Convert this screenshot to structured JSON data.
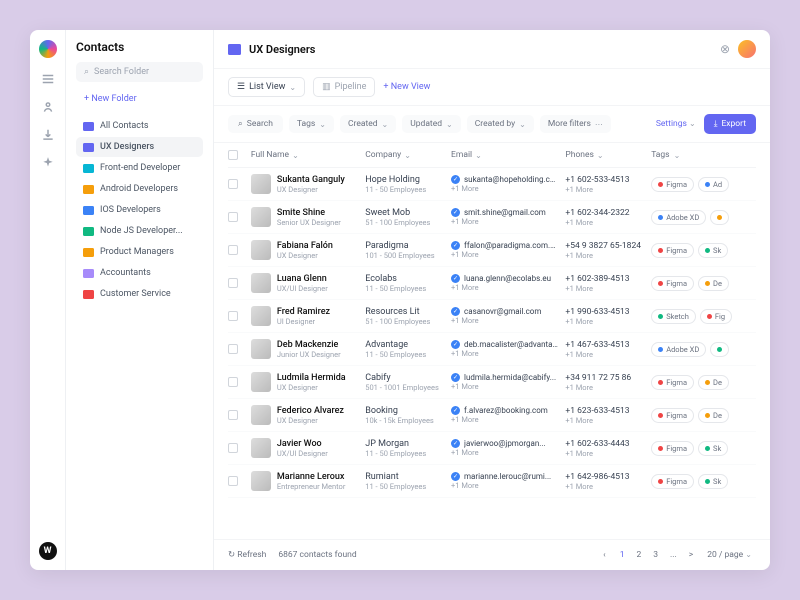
{
  "sidebar": {
    "title": "Contacts",
    "search_placeholder": "Search Folder",
    "new_folder": "+   New Folder",
    "folders": [
      {
        "label": "All Contacts",
        "color": "#6366f1"
      },
      {
        "label": "UX Designers",
        "color": "#6366f1",
        "active": true
      },
      {
        "label": "Front-end Developer",
        "color": "#06b6d4"
      },
      {
        "label": "Android Developers",
        "color": "#f59e0b"
      },
      {
        "label": "IOS Developers",
        "color": "#3b82f6"
      },
      {
        "label": "Node JS Developer...",
        "color": "#10b981"
      },
      {
        "label": "Product Managers",
        "color": "#f59e0b"
      },
      {
        "label": "Accountants",
        "color": "#a78bfa"
      },
      {
        "label": "Customer Service",
        "color": "#ef4444"
      }
    ]
  },
  "header": {
    "title": "UX Designers",
    "folder_color": "#6366f1"
  },
  "views": {
    "list": "List View",
    "pipeline": "Pipeline",
    "new": "+   New View"
  },
  "filters": {
    "search": "Search",
    "chips": [
      "Tags",
      "Created",
      "Updated",
      "Created by",
      "More filters"
    ],
    "settings": "Settings",
    "export": "Export"
  },
  "columns": [
    "Full Name",
    "Company",
    "Email",
    "Phones",
    "Tags"
  ],
  "rows": [
    {
      "name": "Sukanta Ganguly",
      "role": "UX Designer",
      "company": "Hope Holding",
      "size": "11 - 50 Employees",
      "email": "sukanta@hopeholding.com",
      "emore": "+1 More",
      "phone": "+1 602-533-4513",
      "pmore": "+1 More",
      "tags": [
        {
          "t": "Figma",
          "c": "#ef4444"
        },
        {
          "t": "Ad",
          "c": "#3b82f6"
        }
      ]
    },
    {
      "name": "Smite Shine",
      "role": "Senior UX Designer",
      "company": "Sweet Mob",
      "size": "51 - 100 Employees",
      "email": "smit.shine@gmail.com",
      "emore": "+1 More",
      "phone": "+1 602-344-2322",
      "pmore": "+1 More",
      "tags": [
        {
          "t": "Adobe XD",
          "c": "#3b82f6"
        },
        {
          "t": "",
          "c": "#f59e0b"
        }
      ]
    },
    {
      "name": "Fabiana Falón",
      "role": "UX Designer",
      "company": "Paradigma",
      "size": "101 - 500 Employees",
      "email": "ffalon@paradigma.com.mx",
      "emore": "+1 More",
      "phone": "+54 9 3827 65-1824",
      "pmore": "+1 More",
      "tags": [
        {
          "t": "Figma",
          "c": "#ef4444"
        },
        {
          "t": "Sk",
          "c": "#10b981"
        }
      ]
    },
    {
      "name": "Luana Glenn",
      "role": "UX/UI Designer",
      "company": "Ecolabs",
      "size": "11 - 50 Employees",
      "email": "luana.glenn@ecolabs.eu",
      "emore": "+1 More",
      "phone": "+1 602-389-4513",
      "pmore": "+1 More",
      "tags": [
        {
          "t": "Figma",
          "c": "#ef4444"
        },
        {
          "t": "De",
          "c": "#f59e0b"
        }
      ]
    },
    {
      "name": "Fred Ramirez",
      "role": "UI Designer",
      "company": "Resources Lit",
      "size": "51 - 100 Employees",
      "email": "casanovr@gmail.com",
      "emore": "+1 More",
      "phone": "+1 990-633-4513",
      "pmore": "+1 More",
      "tags": [
        {
          "t": "Sketch",
          "c": "#10b981"
        },
        {
          "t": "Fig",
          "c": "#ef4444"
        }
      ]
    },
    {
      "name": "Deb Mackenzie",
      "role": "Junior UX Designer",
      "company": "Advantage",
      "size": "11 - 50 Employees",
      "email": "deb.macalister@advantage...",
      "emore": "+1 More",
      "phone": "+1 467-633-4513",
      "pmore": "+1 More",
      "tags": [
        {
          "t": "Adobe XD",
          "c": "#3b82f6"
        },
        {
          "t": "",
          "c": "#10b981"
        }
      ]
    },
    {
      "name": "Ludmila Hermida",
      "role": "UX Designer",
      "company": "Cabify",
      "size": "501 - 1001 Employees",
      "email": "ludmila.hermida@cabify...",
      "emore": "+1 More",
      "phone": "+34 911 72 75 86",
      "pmore": "+1 More",
      "tags": [
        {
          "t": "Figma",
          "c": "#ef4444"
        },
        {
          "t": "De",
          "c": "#f59e0b"
        }
      ]
    },
    {
      "name": "Federico Alvarez",
      "role": "UX Designer",
      "company": "Booking",
      "size": "10k - 15k Employees",
      "email": "f.alvarez@booking.com",
      "emore": "+1 More",
      "phone": "+1 623-633-4513",
      "pmore": "+1 More",
      "tags": [
        {
          "t": "Figma",
          "c": "#ef4444"
        },
        {
          "t": "De",
          "c": "#f59e0b"
        }
      ]
    },
    {
      "name": "Javier Woo",
      "role": "UX/UI Designer",
      "company": "JP Morgan",
      "size": "11 - 50 Employees",
      "email": "javierwoo@jpmorgan...",
      "emore": "+1 More",
      "phone": "+1 602-633-4443",
      "pmore": "+1 More",
      "tags": [
        {
          "t": "Figma",
          "c": "#ef4444"
        },
        {
          "t": "Sk",
          "c": "#10b981"
        }
      ]
    },
    {
      "name": "Marianne Leroux",
      "role": "Entrepreneur Mentor",
      "company": "Rumiant",
      "size": "11 - 50 Employees",
      "email": "marianne.lerouc@rumi...",
      "emore": "+1 More",
      "phone": "+1 642-986-4513",
      "pmore": "+1 More",
      "tags": [
        {
          "t": "Figma",
          "c": "#ef4444"
        },
        {
          "t": "Sk",
          "c": "#10b981"
        }
      ]
    }
  ],
  "footer": {
    "refresh": "Refresh",
    "count": "6867 contacts found",
    "pages": [
      "1",
      "2",
      "3",
      "...",
      ">"
    ],
    "per_page": "20 / page"
  }
}
